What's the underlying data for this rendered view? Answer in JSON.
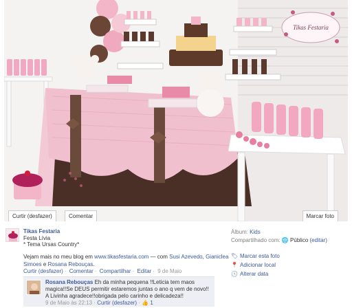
{
  "photo": {
    "watermark": "Tikas Festaria",
    "undo_label": "Curtir (desfazer)",
    "comment_label": "Comentar",
    "tag_label": "Marcar foto"
  },
  "post": {
    "author": "Tikas Festaria",
    "caption_line1": "Festa Lívia",
    "caption_line2": "* Tema Ursas Country*",
    "text_prefix": "Vejam mais no meu blog em",
    "blog_link": "www.tikasfestaria.com",
    "text_with": "— com",
    "tagged_1": "Susi Azevedo",
    "tagged_2": "Gianiclea Simoes",
    "and_word": "e",
    "tagged_3": "Rosana Rebouças",
    "actions": {
      "like_undo": "Curtir (desfazer)",
      "comment": "Comentar",
      "share": "Compartilhar",
      "edit": "Editar",
      "date": "9 de Maio"
    }
  },
  "comment": {
    "author": "Rosana Rebouças",
    "text": "Eh da minha pequena !!Leticia tem maos magica!!Se DEUS permitir estaremos juntas o ano q vem de novo!! A Livinha agradece!!obrigada pelo carinho e delicadeza!!",
    "time": "9 de Maio às 22:13",
    "like_undo": "Curtir (desfazer)",
    "likes": "1"
  },
  "meta": {
    "album_label": "Álbum:",
    "album_value": "Kids",
    "shared_label": "Compartilhado com:",
    "shared_value": "Público",
    "shared_edit": "(editar)",
    "actions": [
      {
        "label": "Marcar esta foto",
        "icon": "tag-icon"
      },
      {
        "label": "Adicionar local",
        "icon": "location-pin-icon"
      },
      {
        "label": "Alterar data",
        "icon": "clock-icon"
      }
    ]
  },
  "colors": {
    "link": "#3b5998",
    "tablecloth_pink": "#f2c4d3",
    "chocolate": "#5a3a2e",
    "comment_bg": "#edeff4"
  }
}
